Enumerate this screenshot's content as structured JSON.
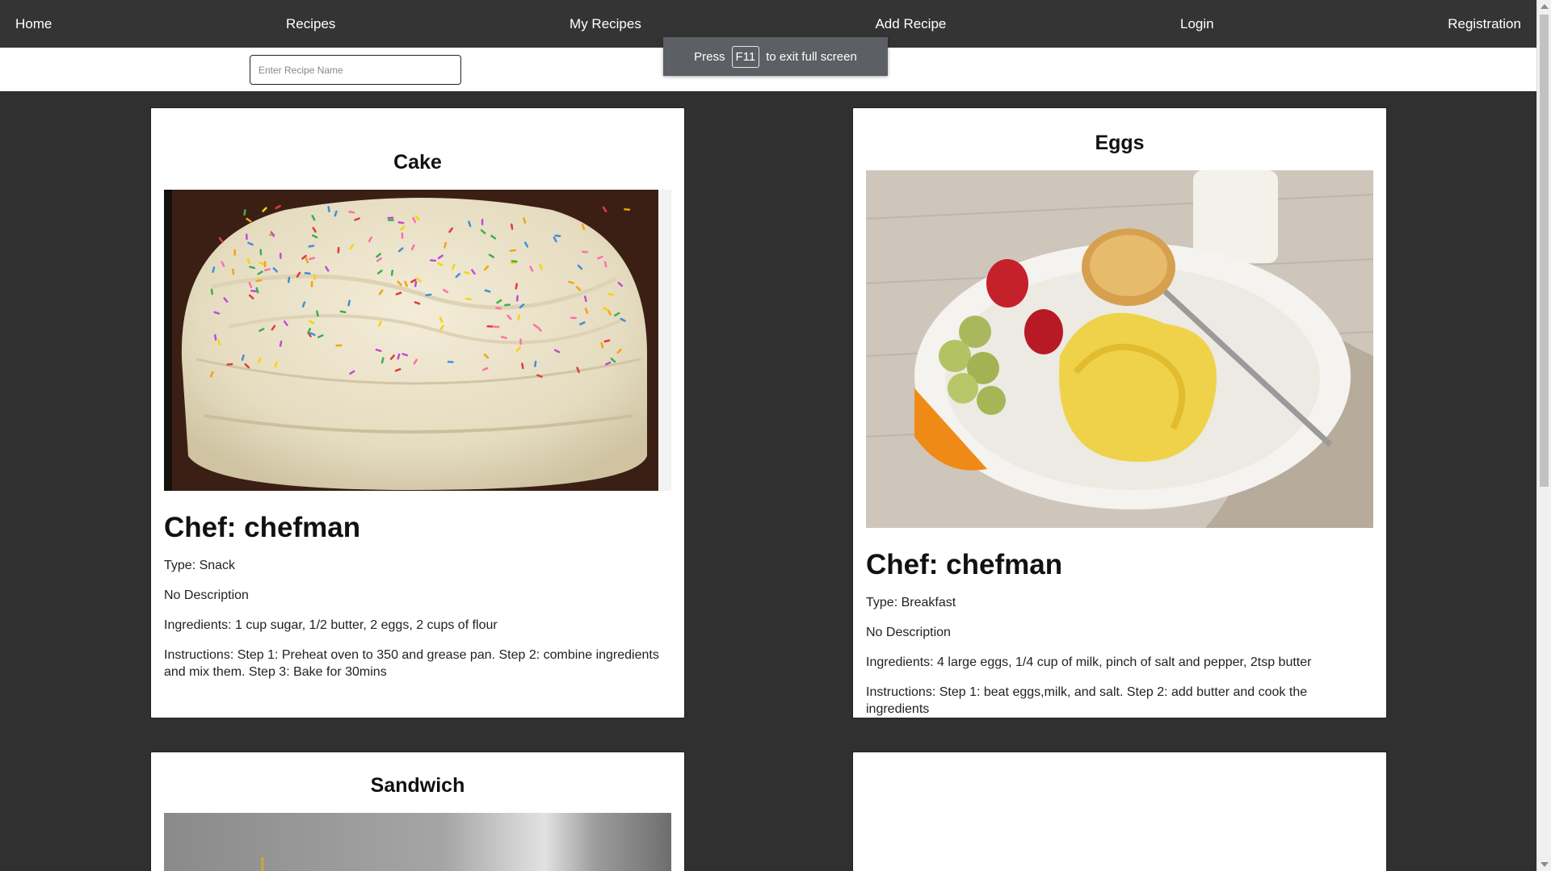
{
  "nav": {
    "items": [
      {
        "label": "Home"
      },
      {
        "label": "Recipes"
      },
      {
        "label": "My Recipes"
      },
      {
        "label": "Add Recipe"
      },
      {
        "label": "Login"
      },
      {
        "label": "Registration"
      }
    ]
  },
  "search": {
    "placeholder": "Enter Recipe Name",
    "value": ""
  },
  "fullscreen_toast": {
    "before": "Press",
    "key": "F11",
    "after": "to exit full screen"
  },
  "colors": {
    "background": "#303030",
    "navbar": "#343434",
    "card": "#ffffff",
    "toast": "#5c5f63"
  },
  "recipes": [
    {
      "title": "Cake",
      "image_icon": "cake-photo",
      "chef": "Chef: chefman",
      "type": "Type: Snack",
      "description": "No Description",
      "ingredients": "Ingredients: 1 cup sugar, 1/2 butter, 2 eggs, 2 cups of flour",
      "instructions": "Instructions: Step 1: Preheat oven to 350 and grease pan. Step 2: combine ingredients and mix them. Step 3: Bake for 30mins"
    },
    {
      "title": "Eggs",
      "image_icon": "eggs-breakfast-photo",
      "chef": "Chef: chefman",
      "type": "Type: Breakfast",
      "description": "No Description",
      "ingredients": "Ingredients: 4 large eggs, 1/4 cup of milk, pinch of salt and pepper, 2tsp butter",
      "instructions": "Instructions: Step 1: beat eggs,milk, and salt. Step 2: add butter and cook the ingredients"
    },
    {
      "title": "Sandwich",
      "image_icon": "sandwich-photo"
    }
  ]
}
